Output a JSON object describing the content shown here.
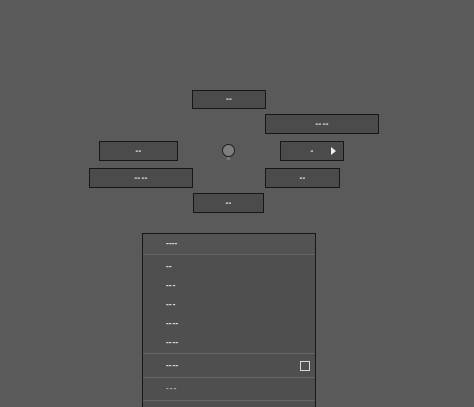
{
  "pie_menu": {
    "top": "▬▬",
    "top_right": "▬▬ ▬▬",
    "left": "▬▬",
    "right": "▬",
    "bottom_left": "▬▬ ▬▬",
    "bottom_right": "▬▬",
    "bottom": "▬▬"
  },
  "panel": {
    "header": "▬▬▬▬",
    "items": [
      "▬▬",
      "▬▬ ▬",
      "▬▬ ▬",
      "▬▬ ▬▬",
      "▬▬ ▬▬"
    ],
    "checkbox_label": "▬▬ ▬▬",
    "last_item": "▬ ▬ ▬"
  },
  "icons": {
    "submenu": "triangle-right",
    "center": "circle"
  }
}
